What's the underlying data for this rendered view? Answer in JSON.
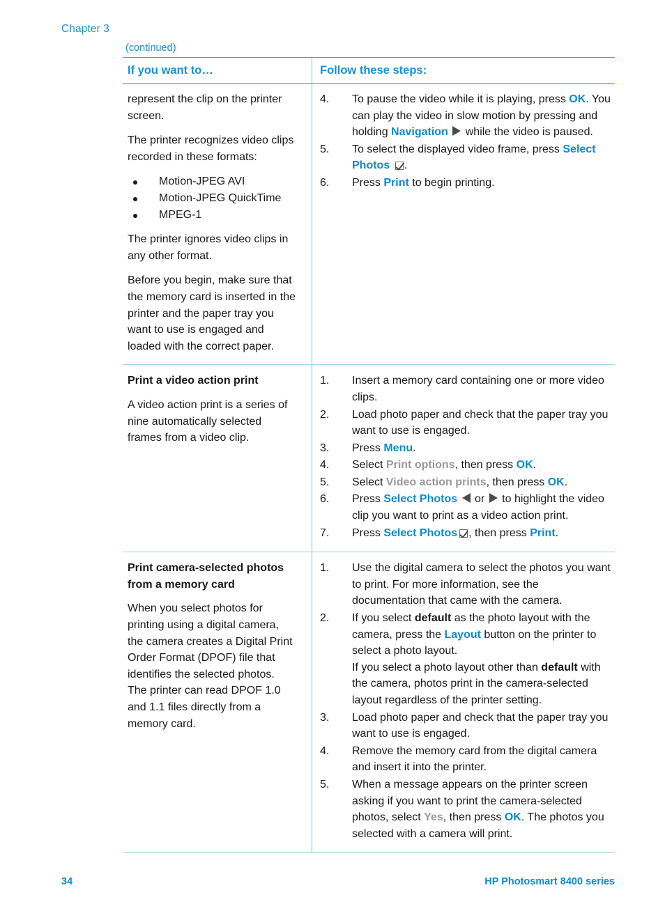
{
  "page": {
    "chapter_label": "Chapter 3",
    "continued_label": "(continued)",
    "footer_page_number": "34",
    "footer_product": "HP Photosmart 8400 series",
    "accent_blue": "#0b8ccd",
    "rule_blue": "#9dd4ea",
    "dim_gray": "#9a9a9a"
  },
  "table": {
    "headers": {
      "left": "If you want to…",
      "right": "Follow these steps:"
    },
    "rows": [
      {
        "left": {
          "paragraphs": [
            "represent the clip on the printer screen.",
            "The printer recognizes video clips recorded in these formats:"
          ],
          "bullets": [
            "Motion-JPEG AVI",
            "Motion-JPEG QuickTime",
            "MPEG-1"
          ],
          "paragraphs_after": [
            "The printer ignores video clips in any other format.",
            "Before you begin, make sure that the memory card is inserted in the printer and the paper tray you want to use is engaged and loaded with the correct paper."
          ]
        },
        "steps": [
          {
            "num": "4.",
            "segments": [
              {
                "t": "To pause the video while it is playing, press "
              },
              {
                "t": "OK",
                "s": "ui"
              },
              {
                "t": ". You can play the video in slow motion by pressing and holding "
              },
              {
                "t": "Navigation",
                "s": "ui"
              },
              {
                "t": " ",
                "icon": "triangle-right-icon"
              },
              {
                "t": " while the video is paused."
              }
            ]
          },
          {
            "num": "5.",
            "segments": [
              {
                "t": "To select the displayed video frame, press "
              },
              {
                "t": "Select Photos",
                "s": "ui"
              },
              {
                "t": " ",
                "icon": "checkbox-check-icon"
              },
              {
                "t": "."
              }
            ]
          },
          {
            "num": "6.",
            "segments": [
              {
                "t": "Press "
              },
              {
                "t": "Print",
                "s": "ui"
              },
              {
                "t": " to begin printing."
              }
            ]
          }
        ]
      },
      {
        "left": {
          "subhead": "Print a video action print",
          "paragraphs_after": [
            "A video action print is a series of nine automatically selected frames from a video clip."
          ]
        },
        "steps": [
          {
            "num": "1.",
            "segments": [
              {
                "t": "Insert a memory card containing one or more video clips."
              }
            ]
          },
          {
            "num": "2.",
            "segments": [
              {
                "t": "Load photo paper and check that the paper tray you want to use is engaged."
              }
            ]
          },
          {
            "num": "3.",
            "segments": [
              {
                "t": "Press "
              },
              {
                "t": "Menu",
                "s": "ui"
              },
              {
                "t": "."
              }
            ]
          },
          {
            "num": "4.",
            "segments": [
              {
                "t": "Select "
              },
              {
                "t": "Print options",
                "s": "uidim"
              },
              {
                "t": ", then press "
              },
              {
                "t": "OK",
                "s": "ui"
              },
              {
                "t": "."
              }
            ]
          },
          {
            "num": "5.",
            "segments": [
              {
                "t": "Select "
              },
              {
                "t": "Video action prints",
                "s": "uidim"
              },
              {
                "t": ", then press "
              },
              {
                "t": "OK",
                "s": "ui"
              },
              {
                "t": "."
              }
            ]
          },
          {
            "num": "6.",
            "segments": [
              {
                "t": "Press "
              },
              {
                "t": "Select Photos",
                "s": "ui"
              },
              {
                "t": " ",
                "icon": "triangle-left-icon"
              },
              {
                "t": " or "
              },
              {
                "t": "",
                "icon": "triangle-right-icon"
              },
              {
                "t": " to highlight the video clip you want to print as a video action print."
              }
            ]
          },
          {
            "num": "7.",
            "segments": [
              {
                "t": "Press "
              },
              {
                "t": "Select Photos",
                "s": "ui"
              },
              {
                "t": "",
                "icon": "checkbox-check-icon"
              },
              {
                "t": ", then press "
              },
              {
                "t": "Print",
                "s": "ui"
              },
              {
                "t": "."
              }
            ]
          }
        ]
      },
      {
        "left": {
          "subhead": "Print camera-selected photos from a memory card",
          "paragraphs_after": [
            "When you select photos for printing using a digital camera, the camera creates a Digital Print Order Format (DPOF) file that identifies the selected photos. The printer can read DPOF 1.0 and 1.1 files directly from a memory card."
          ]
        },
        "steps": [
          {
            "num": "1.",
            "segments": [
              {
                "t": "Use the digital camera to select the photos you want to print. For more information, see the documentation that came with the camera."
              }
            ]
          },
          {
            "num": "2.",
            "segments": [
              {
                "t": "If you select "
              },
              {
                "t": "default",
                "s": "bold"
              },
              {
                "t": " as the photo layout with the camera, press the "
              },
              {
                "t": "Layout",
                "s": "ui"
              },
              {
                "t": " button on the printer to select a photo layout."
              },
              {
                "t": "If you select a photo layout other than ",
                "br": true
              },
              {
                "t": "default",
                "s": "bold"
              },
              {
                "t": " with the camera, photos print in the camera-selected layout regardless of the printer setting."
              }
            ]
          },
          {
            "num": "3.",
            "segments": [
              {
                "t": "Load photo paper and check that the paper tray you want to use is engaged."
              }
            ]
          },
          {
            "num": "4.",
            "segments": [
              {
                "t": "Remove the memory card from the digital camera and insert it into the printer."
              }
            ]
          },
          {
            "num": "5.",
            "segments": [
              {
                "t": "When a message appears on the printer screen asking if you want to print the camera-selected photos, select "
              },
              {
                "t": "Yes",
                "s": "uidim"
              },
              {
                "t": ", then press "
              },
              {
                "t": "OK",
                "s": "ui"
              },
              {
                "t": ". The photos you selected with a camera will print."
              }
            ]
          }
        ]
      }
    ]
  }
}
